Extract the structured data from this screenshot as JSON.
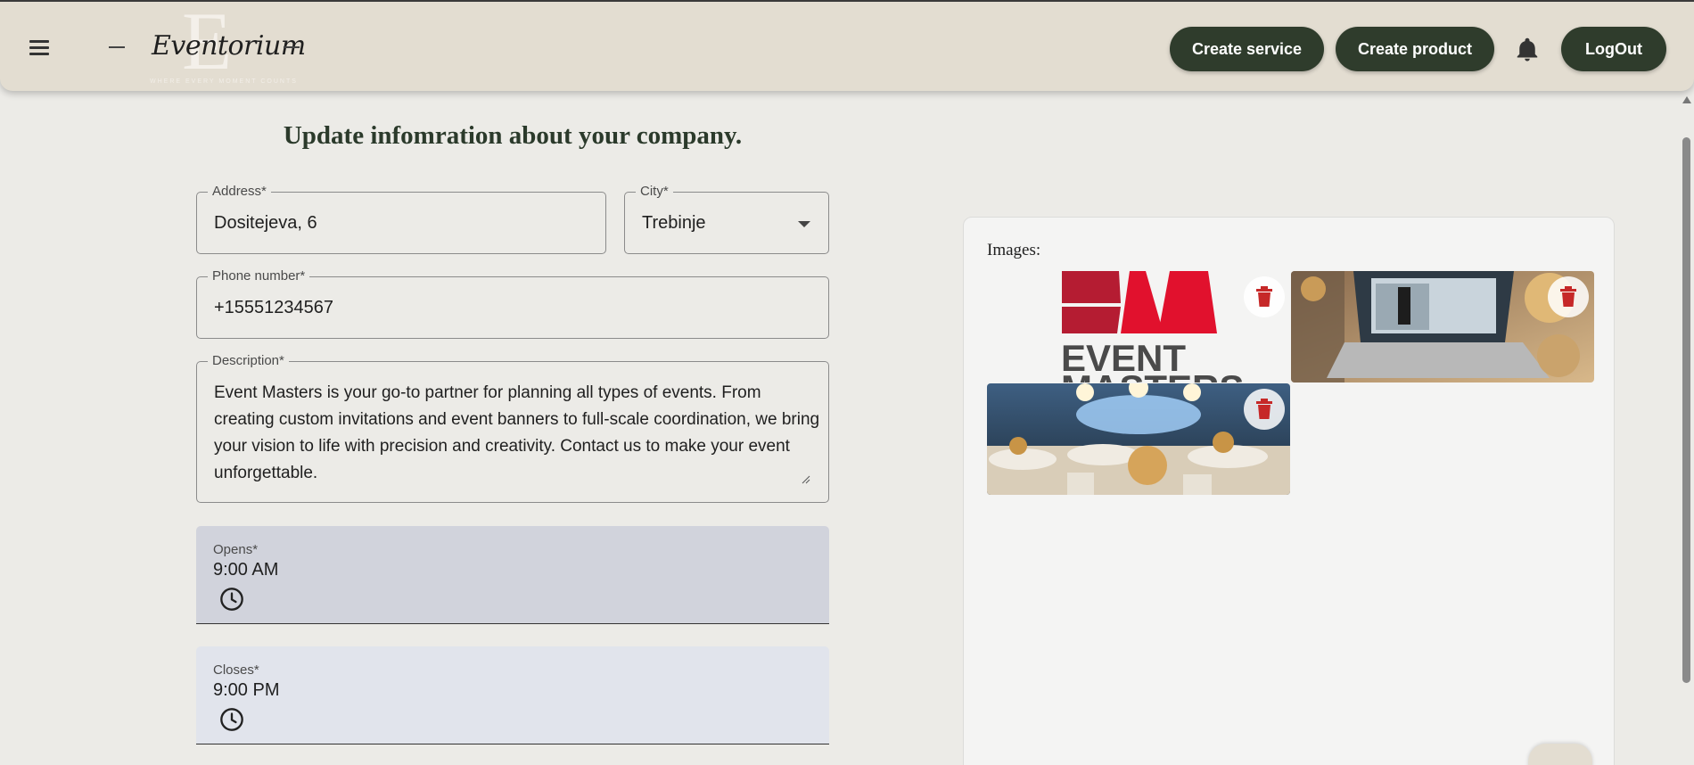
{
  "header": {
    "brand": "Eventorium",
    "brand_monogram": "E",
    "brand_tagline": "WHERE EVERY MOMENT COUNTS",
    "create_service_label": "Create service",
    "create_product_label": "Create product",
    "logout_label": "LogOut"
  },
  "form": {
    "title": "Update infomration about your company.",
    "address": {
      "label": "Address*",
      "value": "Dositejeva, 6"
    },
    "city": {
      "label": "City*",
      "value": "Trebinje"
    },
    "phone": {
      "label": "Phone number*",
      "value": "+15551234567"
    },
    "description": {
      "label": "Description*",
      "value": "Event Masters is your go-to partner for planning all types of events. From creating custom invitations and event banners to full-scale coordination, we bring your vision to life with precision and creativity. Contact us to make your event unforgettable."
    },
    "opens": {
      "label": "Opens*",
      "value": "9:00 AM"
    },
    "closes": {
      "label": "Closes*",
      "value": "9:00 PM"
    }
  },
  "images": {
    "label": "Images:",
    "logo_text_1": "EVENT",
    "logo_text_2": "MASTERS"
  },
  "colors": {
    "header_bg": "#e3ddd1",
    "page_bg": "#ecebe7",
    "button_bg": "#2f3c2c",
    "title_color": "#2b3a2b",
    "delete_icon": "#c62828",
    "opens_bg": "#d1d3dc",
    "closes_bg": "#e1e4ec"
  }
}
